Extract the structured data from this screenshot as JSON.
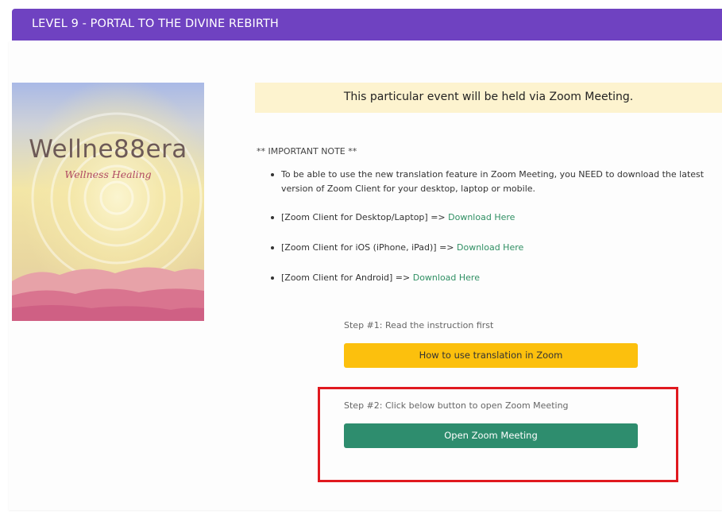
{
  "header": {
    "title": "LEVEL 9 - PORTAL TO THE DIVINE REBIRTH",
    "background_color": "#6f42c1"
  },
  "cover": {
    "brand_name": "Wellne88era",
    "tagline": "Wellness Healing"
  },
  "notice": {
    "text": "This particular event will be held via Zoom Meeting.",
    "background_color": "#fdf3cf"
  },
  "important_note": {
    "heading": "** IMPORTANT NOTE **",
    "items": [
      {
        "text": "To be able to use the new translation feature in Zoom Meeting, you NEED to download the latest version of Zoom Client for your desktop, laptop or mobile."
      },
      {
        "text": "[Zoom Client for Desktop/Laptop] => ",
        "link": "Download Here"
      },
      {
        "text": "[Zoom Client for iOS (iPhone, iPad)] => ",
        "link": "Download Here"
      },
      {
        "text": "[Zoom Client for Android] => ",
        "link": "Download Here"
      }
    ],
    "link_color": "#2f8f63"
  },
  "step1": {
    "label": "Step #1: Read the instruction first",
    "button_label": "How to use translation in Zoom",
    "button_color": "#fcc00d"
  },
  "step2": {
    "label": "Step #2: Click below button to open Zoom Meeting",
    "button_label": "Open Zoom Meeting",
    "button_color": "#2e8d6e",
    "highlight_color": "#e0191f"
  }
}
